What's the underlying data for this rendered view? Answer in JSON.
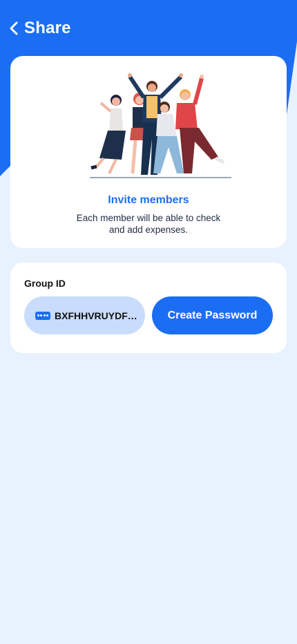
{
  "header": {
    "title": "Share"
  },
  "invite": {
    "title": "Invite members",
    "description": "Each member will be able to check and add expenses."
  },
  "group": {
    "label": "Group ID",
    "id_value": "BXFHHVRUYDFGHJK",
    "create_password_label": "Create Password"
  },
  "colors": {
    "primary": "#1B6EF3",
    "background": "#E8F1FE",
    "pill": "#C9DCFB"
  }
}
